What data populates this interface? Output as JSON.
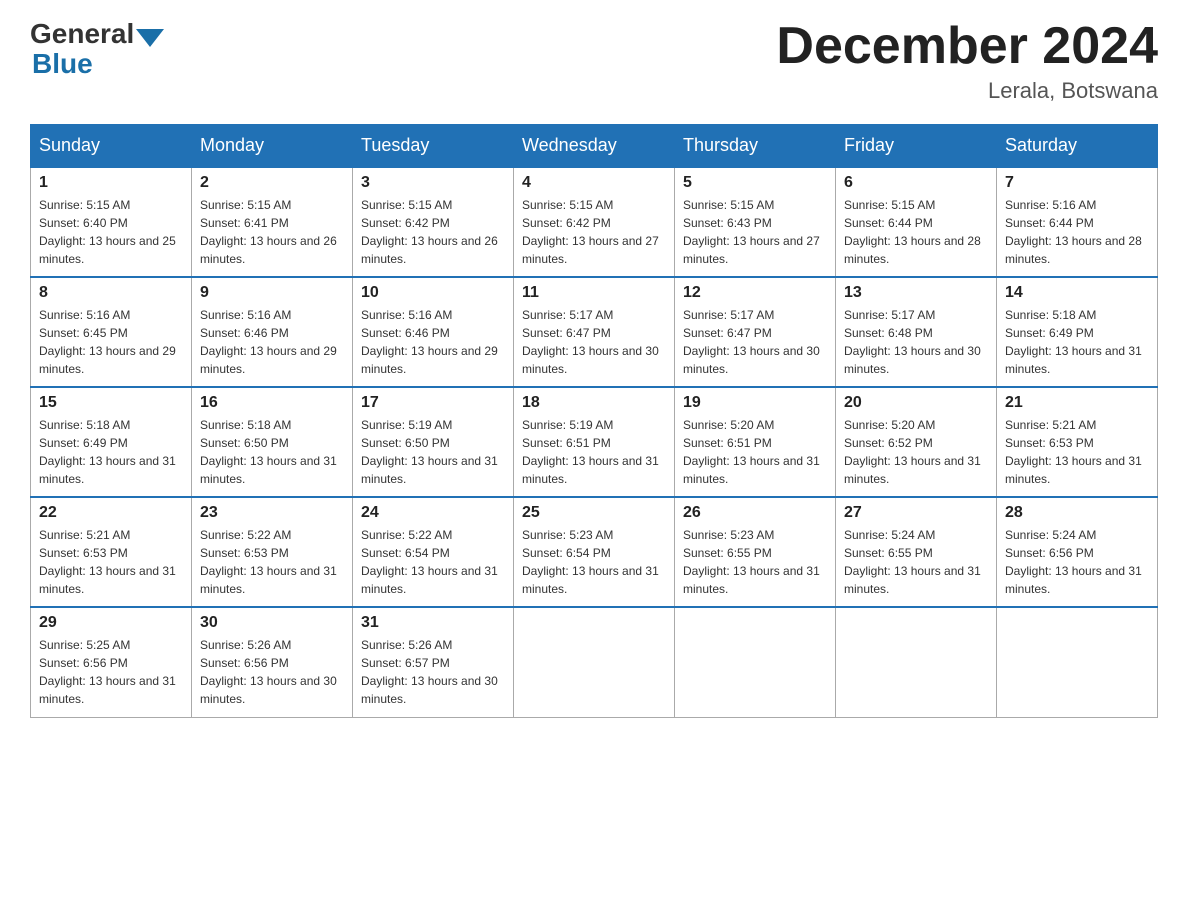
{
  "header": {
    "logo_general": "General",
    "logo_blue": "Blue",
    "month_title": "December 2024",
    "location": "Lerala, Botswana"
  },
  "days_of_week": [
    "Sunday",
    "Monday",
    "Tuesday",
    "Wednesday",
    "Thursday",
    "Friday",
    "Saturday"
  ],
  "weeks": [
    [
      {
        "day": "1",
        "sunrise": "5:15 AM",
        "sunset": "6:40 PM",
        "daylight": "13 hours and 25 minutes."
      },
      {
        "day": "2",
        "sunrise": "5:15 AM",
        "sunset": "6:41 PM",
        "daylight": "13 hours and 26 minutes."
      },
      {
        "day": "3",
        "sunrise": "5:15 AM",
        "sunset": "6:42 PM",
        "daylight": "13 hours and 26 minutes."
      },
      {
        "day": "4",
        "sunrise": "5:15 AM",
        "sunset": "6:42 PM",
        "daylight": "13 hours and 27 minutes."
      },
      {
        "day": "5",
        "sunrise": "5:15 AM",
        "sunset": "6:43 PM",
        "daylight": "13 hours and 27 minutes."
      },
      {
        "day": "6",
        "sunrise": "5:15 AM",
        "sunset": "6:44 PM",
        "daylight": "13 hours and 28 minutes."
      },
      {
        "day": "7",
        "sunrise": "5:16 AM",
        "sunset": "6:44 PM",
        "daylight": "13 hours and 28 minutes."
      }
    ],
    [
      {
        "day": "8",
        "sunrise": "5:16 AM",
        "sunset": "6:45 PM",
        "daylight": "13 hours and 29 minutes."
      },
      {
        "day": "9",
        "sunrise": "5:16 AM",
        "sunset": "6:46 PM",
        "daylight": "13 hours and 29 minutes."
      },
      {
        "day": "10",
        "sunrise": "5:16 AM",
        "sunset": "6:46 PM",
        "daylight": "13 hours and 29 minutes."
      },
      {
        "day": "11",
        "sunrise": "5:17 AM",
        "sunset": "6:47 PM",
        "daylight": "13 hours and 30 minutes."
      },
      {
        "day": "12",
        "sunrise": "5:17 AM",
        "sunset": "6:47 PM",
        "daylight": "13 hours and 30 minutes."
      },
      {
        "day": "13",
        "sunrise": "5:17 AM",
        "sunset": "6:48 PM",
        "daylight": "13 hours and 30 minutes."
      },
      {
        "day": "14",
        "sunrise": "5:18 AM",
        "sunset": "6:49 PM",
        "daylight": "13 hours and 31 minutes."
      }
    ],
    [
      {
        "day": "15",
        "sunrise": "5:18 AM",
        "sunset": "6:49 PM",
        "daylight": "13 hours and 31 minutes."
      },
      {
        "day": "16",
        "sunrise": "5:18 AM",
        "sunset": "6:50 PM",
        "daylight": "13 hours and 31 minutes."
      },
      {
        "day": "17",
        "sunrise": "5:19 AM",
        "sunset": "6:50 PM",
        "daylight": "13 hours and 31 minutes."
      },
      {
        "day": "18",
        "sunrise": "5:19 AM",
        "sunset": "6:51 PM",
        "daylight": "13 hours and 31 minutes."
      },
      {
        "day": "19",
        "sunrise": "5:20 AM",
        "sunset": "6:51 PM",
        "daylight": "13 hours and 31 minutes."
      },
      {
        "day": "20",
        "sunrise": "5:20 AM",
        "sunset": "6:52 PM",
        "daylight": "13 hours and 31 minutes."
      },
      {
        "day": "21",
        "sunrise": "5:21 AM",
        "sunset": "6:53 PM",
        "daylight": "13 hours and 31 minutes."
      }
    ],
    [
      {
        "day": "22",
        "sunrise": "5:21 AM",
        "sunset": "6:53 PM",
        "daylight": "13 hours and 31 minutes."
      },
      {
        "day": "23",
        "sunrise": "5:22 AM",
        "sunset": "6:53 PM",
        "daylight": "13 hours and 31 minutes."
      },
      {
        "day": "24",
        "sunrise": "5:22 AM",
        "sunset": "6:54 PM",
        "daylight": "13 hours and 31 minutes."
      },
      {
        "day": "25",
        "sunrise": "5:23 AM",
        "sunset": "6:54 PM",
        "daylight": "13 hours and 31 minutes."
      },
      {
        "day": "26",
        "sunrise": "5:23 AM",
        "sunset": "6:55 PM",
        "daylight": "13 hours and 31 minutes."
      },
      {
        "day": "27",
        "sunrise": "5:24 AM",
        "sunset": "6:55 PM",
        "daylight": "13 hours and 31 minutes."
      },
      {
        "day": "28",
        "sunrise": "5:24 AM",
        "sunset": "6:56 PM",
        "daylight": "13 hours and 31 minutes."
      }
    ],
    [
      {
        "day": "29",
        "sunrise": "5:25 AM",
        "sunset": "6:56 PM",
        "daylight": "13 hours and 31 minutes."
      },
      {
        "day": "30",
        "sunrise": "5:26 AM",
        "sunset": "6:56 PM",
        "daylight": "13 hours and 30 minutes."
      },
      {
        "day": "31",
        "sunrise": "5:26 AM",
        "sunset": "6:57 PM",
        "daylight": "13 hours and 30 minutes."
      },
      null,
      null,
      null,
      null
    ]
  ],
  "labels": {
    "sunrise_prefix": "Sunrise: ",
    "sunset_prefix": "Sunset: ",
    "daylight_prefix": "Daylight: "
  }
}
